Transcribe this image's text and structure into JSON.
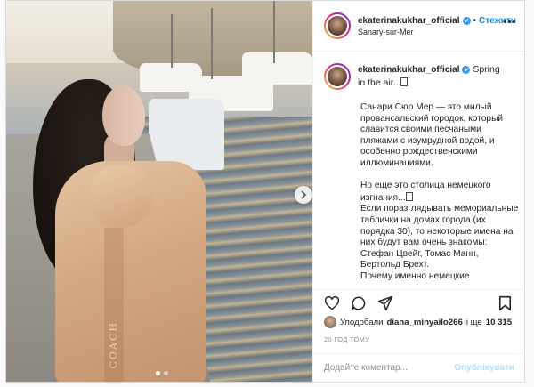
{
  "colors": {
    "accent": "#0095f6",
    "verified": "#3897f0",
    "text": "#262626",
    "muted": "#8e8e8e",
    "post_disabled": "#b2dffc"
  },
  "post": {
    "username": "ekaterinakukhar_official",
    "verified": true,
    "follow_label": "Стежити",
    "separator": "•",
    "location": "Sanary-sur-Mer",
    "image": {
      "brand_text": "COACH",
      "carousel_dots": 2,
      "active_dot": 1
    },
    "caption": {
      "first_line": "Spring in the air...",
      "paragraph1": "Санари Сюр Мер — это милый провансальский городок, который славится своими песчаными пляжами с изумрудной водой, и особенно рождественскими иллюминациями.",
      "line_exile": "Но еще это столица немецкого изгнания...",
      "paragraph2": "Если поразглядывать мемориальные таблички на домах города (их порядка 30), то некоторые имена на них будут вам очень знакомы: Стефан Цвейг, Томас Манн, Бертольд Брехт.",
      "paragraph3": "Почему именно немецкие"
    },
    "likes": {
      "prefix": "Уподобали",
      "user": "diana_minyailo266",
      "middle": "і ще",
      "count": "10 315"
    },
    "time_ago": "20 ГОД ТОМУ",
    "comment": {
      "placeholder": "Додайте коментар...",
      "post_label": "Опублікувати"
    },
    "icons": [
      "heart-icon",
      "comment-icon",
      "share-icon",
      "bookmark-icon",
      "more-icon",
      "next-arrow-icon",
      "verified-icon"
    ]
  }
}
